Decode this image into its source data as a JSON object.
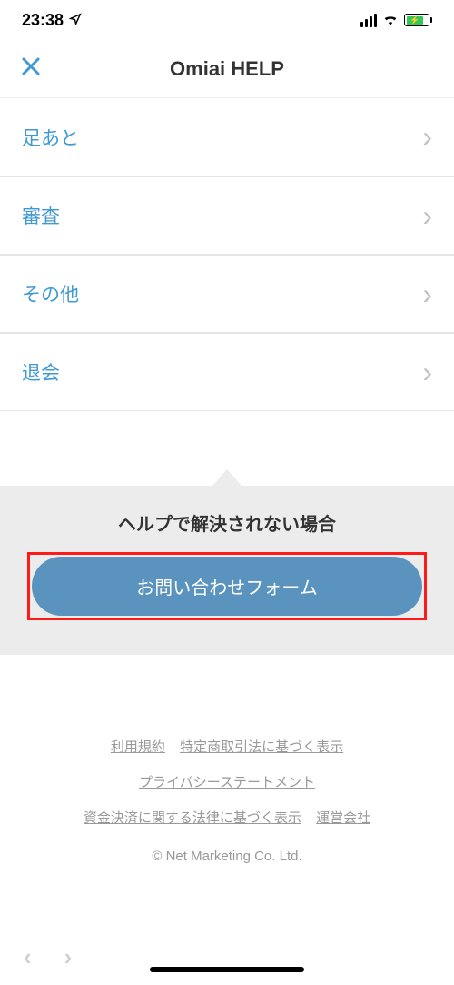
{
  "status": {
    "time": "23:38"
  },
  "header": {
    "title": "Omiai HELP"
  },
  "menu": {
    "items": [
      {
        "label": "足あと"
      },
      {
        "label": "審査"
      },
      {
        "label": "その他"
      },
      {
        "label": "退会"
      }
    ]
  },
  "contact": {
    "heading": "ヘルプで解決されない場合",
    "button": "お問い合わせフォーム"
  },
  "footer": {
    "links": {
      "terms": "利用規約",
      "commerce": "特定商取引法に基づく表示",
      "privacy": "プライバシーステートメント",
      "settlement": "資金決済に関する法律に基づく表示",
      "company": "運営会社"
    },
    "copyright": "© Net Marketing Co. Ltd."
  }
}
